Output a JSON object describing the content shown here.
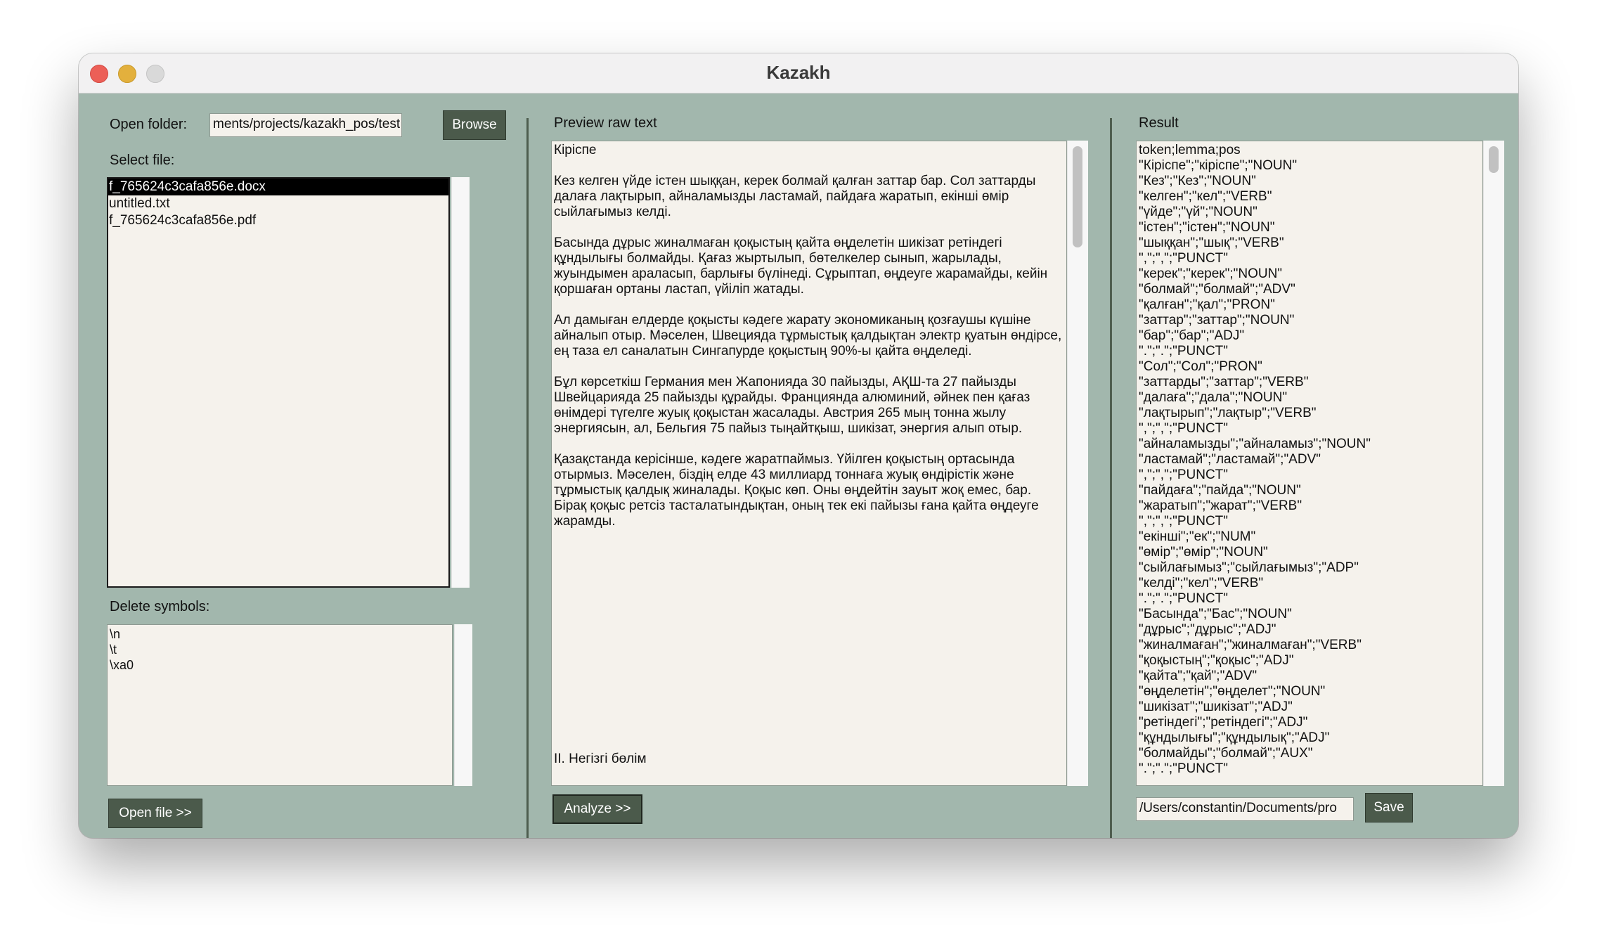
{
  "window": {
    "title": "Kazakh"
  },
  "left": {
    "open_folder_label": "Open folder:",
    "folder_path": "ments/projects/kazakh_pos/test",
    "browse_label": "Browse",
    "select_file_label": "Select file:",
    "files": [
      "f_765624c3cafa856e.docx",
      "untitled.txt",
      "f_765624c3cafa856e.pdf"
    ],
    "delete_symbols_label": "Delete symbols:",
    "delete_symbols": [
      "\\n",
      "\\t",
      "\\xa0"
    ],
    "open_file_label": "Open file >>"
  },
  "middle": {
    "preview_label": "Preview raw text",
    "paragraphs": [
      "Кіріспе",
      "Кез келген үйде істен шыққан, керек болмай қалған заттар бар. Сол заттарды далаға лақтырып, айналамызды ластамай, пайдаға жаратып, екінші өмір сыйлағымыз келді.",
      "Басында дұрыс жиналмаған қоқыстың қайта өңделетін шикізат ретіндегі құндылығы болмайды. Қағаз жыртылып, бөтелкелер сынып, жарылады, жуындымен араласып, барлығы бүлінеді. Сұрыптап, өңдеуге жарамайды, кейін қоршаған ортаны ластап, үйіліп жатады.",
      "Ал дамыған елдерде қоқысты кәдеге жарату экономиканың қозғаушы күшіне айналып отыр. Мәселен, Швецияда тұрмыстық қалдықтан электр қуатын өндірсе, ең таза ел саналатын Сингапурде қоқыстың 90%-ы қайта өңделеді.",
      "Бұл көрсеткіш Германия мен Жапонияда 30 пайызды, АҚШ-та 27 пайызды Швейцарияда 25 пайызды құрайды. Францияндa алюминий, әйнек пен қағаз өнімдері түгелге жуық қоқыстан жасалады. Австрия 265 мың тонна жылу энергиясын, ал, Бельгия 75 пайыз тыңайтқыш, шикізат, энергия алып отыр.",
      "Қазақстанда керісінше, кәдеге жаратпаймыз. Үйілген қоқыстың ортасында отырмыз. Мәселен, біздің елде 43 миллиард тоннаға жуық өндірістік және тұрмыстық қалдық жиналады. Қоқыс көп. Оны өңдейтін зауыт жоқ емес, бар. Бірақ қоқыс ретсіз тасталатындықтан, оның тек екі пайызы ғана қайта өңдеуге жарамды."
    ],
    "bottom_text": "II. Негізгі бөлім",
    "analyze_label": "Analyze >>"
  },
  "right": {
    "result_label": "Result",
    "lines": [
      "token;lemma;pos",
      "\"Кіріспе\";\"кіріспе\";\"NOUN\"",
      "\"Кез\";\"Кез\";\"NOUN\"",
      "\"келген\";\"кел\";\"VERB\"",
      "\"үйде\";\"үй\";\"NOUN\"",
      "\"істен\";\"істен\";\"NOUN\"",
      "\"шыққан\";\"шық\";\"VERB\"",
      "\",\";\",\";\"PUNCT\"",
      "\"керек\";\"керек\";\"NOUN\"",
      "\"болмай\";\"болмай\";\"ADV\"",
      "\"қалған\";\"қал\";\"PRON\"",
      "\"заттар\";\"заттар\";\"NOUN\"",
      "\"бар\";\"бар\";\"ADJ\"",
      "\".\";\".\";\"PUNCT\"",
      "\"Сол\";\"Сол\";\"PRON\"",
      "\"заттарды\";\"заттар\";\"VERB\"",
      "\"далаға\";\"дала\";\"NOUN\"",
      "\"лақтырып\";\"лақтыр\";\"VERB\"",
      "\",\";\",\";\"PUNCT\"",
      "\"айналамызды\";\"айналамыз\";\"NOUN\"",
      "\"ластамай\";\"ластамай\";\"ADV\"",
      "\",\";\",\";\"PUNCT\"",
      "\"пайдаға\";\"пайда\";\"NOUN\"",
      "\"жаратып\";\"жарат\";\"VERB\"",
      "\",\";\",\";\"PUNCT\"",
      "\"екінші\";\"ек\";\"NUM\"",
      "\"өмір\";\"өмір\";\"NOUN\"",
      "\"сыйлағымыз\";\"сыйлағымыз\";\"ADP\"",
      "\"келді\";\"кел\";\"VERB\"",
      "\".\";\".\";\"PUNCT\"",
      "\"Басында\";\"Бас\";\"NOUN\"",
      "\"дұрыс\";\"дұрыс\";\"ADJ\"",
      "\"жиналмаған\";\"жиналмаған\";\"VERB\"",
      "\"қоқыстың\";\"қоқыс\";\"ADJ\"",
      "\"қайта\";\"қай\";\"ADV\"",
      "\"өңделетін\";\"өңделет\";\"NOUN\"",
      "\"шикізат\";\"шикізат\";\"ADJ\"",
      "\"ретіндегі\";\"ретіндегі\";\"ADJ\"",
      "\"құндылығы\";\"құндылық\";\"ADJ\"",
      "\"болмайды\";\"болмай\";\"AUX\"",
      "\".\";\".\";\"PUNCT\""
    ],
    "save_path": "/Users/constantin/Documents/pro",
    "save_label": "Save"
  }
}
